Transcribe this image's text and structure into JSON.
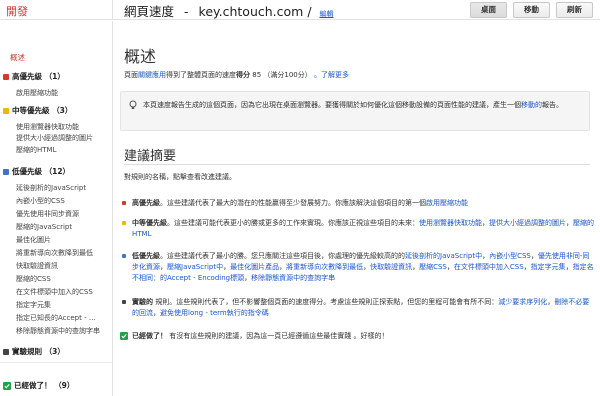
{
  "header": {
    "brand": "開發",
    "title_prefix": "網頁速度",
    "dash": "-",
    "url": "key.chtouch.com",
    "slash": "/",
    "edit_label": "編輯",
    "buttons": {
      "desktop": "桌面",
      "mobile": "移動",
      "refresh": "刷新"
    }
  },
  "sidebar": {
    "overview": "概述",
    "groups": [
      {
        "label": "高優先級 （1）",
        "color": "#d23a2a",
        "items": [
          "啟用壓縮功能"
        ]
      },
      {
        "label": "中等優先級 （3）",
        "color": "#f4b400",
        "items": [
          "使用瀏覽器快取功能",
          "提供大小經過調整的圖片",
          "壓縮的HTML"
        ]
      },
      {
        "label": "低優先級 （12）",
        "color": "#4472c4",
        "items": [
          "延後剖析的JavaScript",
          "內嵌小型的CSS",
          "優先使用非同步資源",
          "壓縮的JavaScript",
          "最佳化圖片",
          "將重新導向次數降到最低",
          "快取驗證資訊",
          "壓縮的CSS",
          "在文件標頭中加入的CSS",
          "指定字元集",
          "指定已知長的Accept - …",
          "移除靜態資源中的查詢字串"
        ]
      },
      {
        "label": "實驗規則 （3）",
        "color": "#444444",
        "items": []
      }
    ],
    "done": {
      "label": "已經做了！ （9）",
      "color": "#22a04a"
    }
  },
  "main": {
    "overview_title": "概述",
    "score_segments": {
      "s1": "頁面",
      "link1": "關鍵應用",
      "s2": "得到了整體頁面的速度",
      "score_label": "得分",
      "score": "85",
      "score_scale": "（滿分100分）",
      "more": "。了解更多"
    },
    "info_text": "本頁速度報告生成的這個頁面，因為它出現在桌面瀏覽器。要獲得關於如何優化這個移動設備的頁面性能的建議，產生一個",
    "info_link": "移動的",
    "info_tail": "報告。",
    "suggestions_title": "建議摘要",
    "intro": "對規則的名稱，點擊查看改進建議。",
    "rules": [
      {
        "color": "#d23a2a",
        "name": "高優先級",
        "text": "。這些建議代表了最大的潛在的性能贏得至少發展努力。你應該解決這個項目的第一個",
        "links": [
          "啟用壓縮功能"
        ]
      },
      {
        "color": "#f4b400",
        "name": "中等優先級",
        "text": "。這些建議可能代表更小的勝或更多的工作來實現。你應該正視這些項目的未來：",
        "links": [
          "使用瀏覽器快取功能",
          "提供大小經過調整的圖片",
          "壓縮的HTML"
        ]
      },
      {
        "color": "#4472c4",
        "name": "低優先級",
        "text": "。這些建議代表了最小的勝。您只應關注這些項目後，你處理的優先級較高的的",
        "links": [
          "延後剖析的JavaScript中",
          "內嵌小型CSS",
          "優先使用非同-同步化資源",
          "壓縮JavaScript中",
          "最佳化圖片產品",
          "將重新導向次數降到最低",
          "快取驗證資訊",
          "壓縮CSS",
          "在文件標頭中加入CSS",
          "指定字元集",
          "指定名不相同：的Accept - Encoding標頭",
          "移除靜態資源中的查詢字串"
        ]
      },
      {
        "color": "#444444",
        "name": "實驗的",
        "text": " 規則。這些規則代表了，但不影響整個頁面的速度得分。考慮這些規則正探索點，但您的里程可能會有所不同：",
        "links": [
          "減少要求序列化",
          "刪除不必要的回流",
          "避免使用long - term執行的指令碼"
        ]
      },
      {
        "color": "#22a04a",
        "name": "已經做了！",
        "text": " 有沒有這些規則的建議，因為這一頁已經遵循這些最佳實踐 。好樣的！",
        "links": []
      }
    ]
  }
}
